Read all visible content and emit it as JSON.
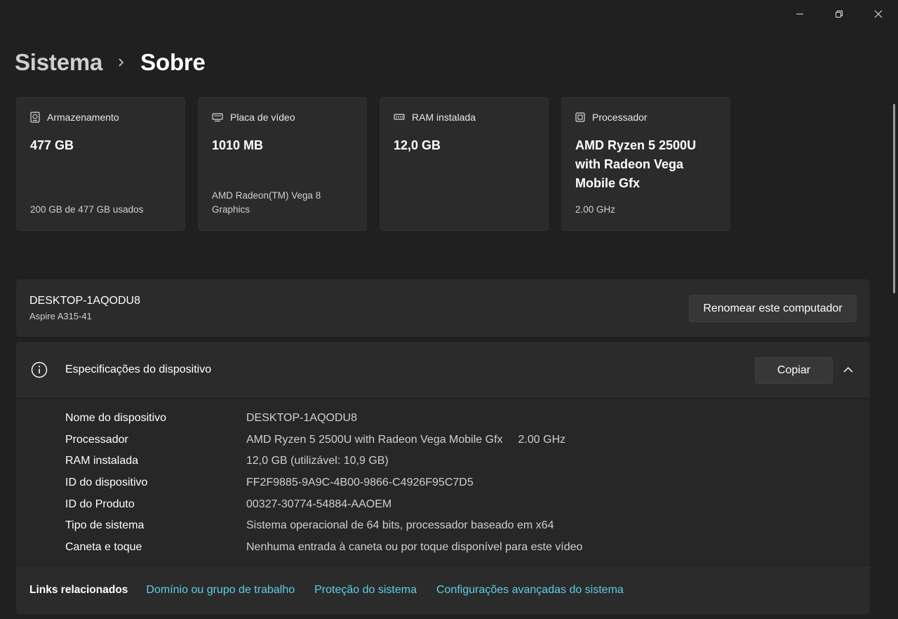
{
  "window_controls": {
    "minimize": "─",
    "maximize": "❐",
    "close": "✕"
  },
  "breadcrumb": {
    "parent": "Sistema",
    "current": "Sobre"
  },
  "cards": [
    {
      "icon": "storage-icon",
      "title": "Armazenamento",
      "value": "477 GB",
      "sub": "200 GB de 477 GB usados"
    },
    {
      "icon": "gpu-icon",
      "title": "Placa de vídeo",
      "value": "1010 MB",
      "sub": "AMD Radeon(TM) Vega 8 Graphics"
    },
    {
      "icon": "ram-icon",
      "title": "RAM instalada",
      "value": "12,0 GB",
      "sub": ""
    },
    {
      "icon": "cpu-icon",
      "title": "Processador",
      "value": "AMD Ryzen 5 2500U with Radeon Vega Mobile Gfx",
      "sub": "2.00 GHz"
    }
  ],
  "device": {
    "name": "DESKTOP-1AQODU8",
    "model": "Aspire A315-41",
    "rename_label": "Renomear este computador"
  },
  "specs": {
    "title": "Especificações do dispositivo",
    "copy_label": "Copiar",
    "rows": [
      {
        "label": "Nome do dispositivo",
        "value": "DESKTOP-1AQODU8",
        "extra": ""
      },
      {
        "label": "Processador",
        "value": "AMD Ryzen 5 2500U with Radeon Vega Mobile Gfx",
        "extra": "2.00 GHz"
      },
      {
        "label": "RAM instalada",
        "value": "12,0 GB (utilizável: 10,9 GB)",
        "extra": ""
      },
      {
        "label": "ID do dispositivo",
        "value": "FF2F9885-9A9C-4B00-9866-C4926F95C7D5",
        "extra": ""
      },
      {
        "label": "ID do Produto",
        "value": "00327-30774-54884-AAOEM",
        "extra": ""
      },
      {
        "label": "Tipo de sistema",
        "value": "Sistema operacional de 64 bits, processador baseado em x64",
        "extra": ""
      },
      {
        "label": "Caneta e toque",
        "value": "Nenhuma entrada à caneta ou por toque disponível para este vídeo",
        "extra": ""
      }
    ]
  },
  "related_links": {
    "label": "Links relacionados",
    "items": [
      "Domínio ou grupo de trabalho",
      "Proteção do sistema",
      "Configurações avançadas do sistema"
    ]
  },
  "colors": {
    "background": "#202020",
    "card": "#2b2b2b",
    "link": "#5ccfe6"
  }
}
